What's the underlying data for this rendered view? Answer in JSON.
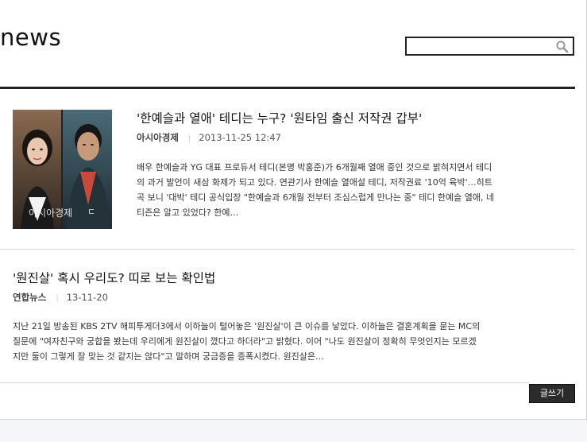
{
  "header": {
    "title": "news",
    "search": {
      "value": "",
      "placeholder": ""
    }
  },
  "articles": [
    {
      "title": "'한예슬과 열애' 테디는 누구? '원타임 출신 저작권 갑부'",
      "source": "아시아경제",
      "separator": "|",
      "date": "2013-11-25 12:47",
      "summary_lines": [
        "배우 한예슬과 YG 대표 프로듀서 테디(본명 박홍준)가 6개월째 열애 중인 것으로 밝혀지면서 테디",
        "의 과거 발언이 새삼 화제가 되고 있다. 연관기사 한예슬 열애설 테디, 저작권료 '10억 육박'…히트",
        "곡 보니 '대박' 테디 공식입장 \"한예슬과 6개월 전부터 조심스럽게 만나는 중\" 테디 한예슬 열애, 네",
        "티즌은 알고 있었다? 한예…"
      ],
      "image_watermark": "아시아경제"
    },
    {
      "title": "'원진살' 혹시 우리도? 띠로 보는 확인법",
      "source": "연합뉴스",
      "separator": "|",
      "date": "13-11-20",
      "summary_lines": [
        "지난 21일 방송된 KBS 2TV 해피투게더3에서 이하늘이 털어놓은 '원진살'이 큰 이슈를 낳았다. 이하늘은 결혼계획을 묻는 MC의",
        "질문에 \"여자친구와 궁합을 봤는데 우리에게 원진살이 꼈다고 하더라\"고 밝혔다. 이어 \"나도 원진살이 정확히 무엇인지는 모르겠",
        "지만 둘이 그렇게 잘 맞는 것 같지는 않다\"고 말하며 궁금증을 증폭시켰다. 원진살은…"
      ]
    }
  ],
  "actions": {
    "write_label": "글쓰기"
  },
  "icons": {
    "search": "search-icon"
  },
  "colors": {
    "header_rule": "#222222",
    "write_button_bg": "#2b2b2b"
  }
}
